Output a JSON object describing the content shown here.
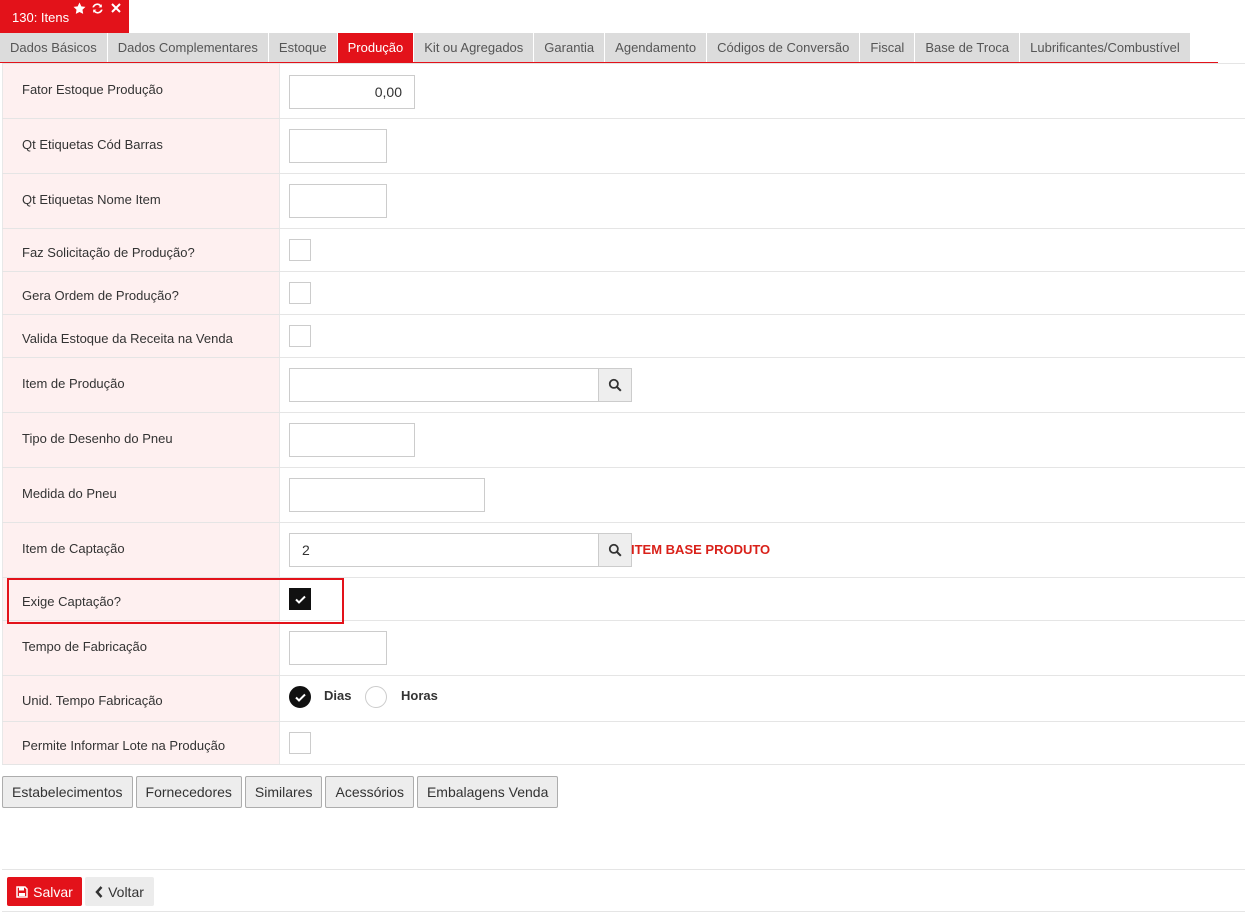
{
  "window": {
    "title": "130: Itens",
    "icons": [
      "star-icon",
      "refresh-icon",
      "close-icon"
    ]
  },
  "tabs": [
    {
      "label": "Dados Básicos",
      "active": false
    },
    {
      "label": "Dados Complementares",
      "active": false
    },
    {
      "label": "Estoque",
      "active": false
    },
    {
      "label": "Produção",
      "active": true
    },
    {
      "label": "Kit ou Agregados",
      "active": false
    },
    {
      "label": "Garantia",
      "active": false
    },
    {
      "label": "Agendamento",
      "active": false
    },
    {
      "label": "Códigos de Conversão",
      "active": false
    },
    {
      "label": "Fiscal",
      "active": false
    },
    {
      "label": "Base de Troca",
      "active": false
    },
    {
      "label": "Lubrificantes/Combustível",
      "active": false
    }
  ],
  "form": {
    "fator_estoque": {
      "label": "Fator Estoque Produção",
      "value": "0,00"
    },
    "qt_etiquetas_cod": {
      "label": "Qt Etiquetas Cód Barras",
      "value": ""
    },
    "qt_etiquetas_nome": {
      "label": "Qt Etiquetas Nome Item",
      "value": ""
    },
    "faz_solicitacao": {
      "label": "Faz Solicitação de Produção?",
      "checked": false
    },
    "gera_ordem": {
      "label": "Gera Ordem de Produção?",
      "checked": false
    },
    "valida_estoque": {
      "label": "Valida Estoque da Receita na Venda",
      "checked": false
    },
    "item_producao": {
      "label": "Item de Produção",
      "value": ""
    },
    "tipo_desenho": {
      "label": "Tipo de Desenho do Pneu",
      "value": ""
    },
    "medida_pneu": {
      "label": "Medida do Pneu",
      "value": ""
    },
    "item_captacao": {
      "label": "Item de Captação",
      "value": "2",
      "description": "ITEM BASE PRODUTO"
    },
    "exige_captacao": {
      "label": "Exige Captação?",
      "checked": true
    },
    "tempo_fabricacao": {
      "label": "Tempo de Fabricação",
      "value": ""
    },
    "unid_tempo": {
      "label": "Unid. Tempo Fabricação",
      "options": [
        "Dias",
        "Horas"
      ],
      "selected": "Dias"
    },
    "permite_lote": {
      "label": "Permite Informar Lote na Produção",
      "checked": false
    }
  },
  "sub_buttons": [
    "Estabelecimentos",
    "Fornecedores",
    "Similares",
    "Acessórios",
    "Embalagens Venda"
  ],
  "footer": {
    "save": "Salvar",
    "back": "Voltar"
  },
  "colors": {
    "accent": "#e3121a",
    "label_bg": "#fef0f0",
    "tab_bg": "#dcdcdc"
  }
}
